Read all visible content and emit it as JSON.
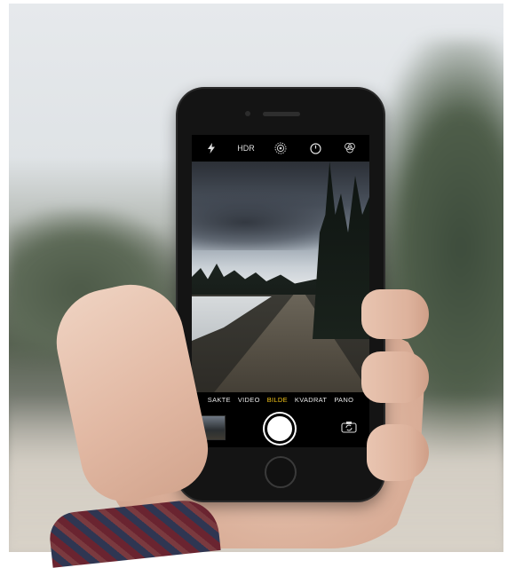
{
  "camera_app": {
    "top_controls": {
      "flash_icon": "flash-icon",
      "hdr_label": "HDR",
      "live_photo_icon": "live-photo-icon",
      "timer_icon": "timer-icon",
      "filters_icon": "filters-icon"
    },
    "modes": [
      {
        "label": "SAKTE",
        "active": false
      },
      {
        "label": "VIDEO",
        "active": false
      },
      {
        "label": "BILDE",
        "active": true
      },
      {
        "label": "KVADRAT",
        "active": false
      },
      {
        "label": "PANO",
        "active": false
      }
    ],
    "bottom_controls": {
      "thumbnail": "last-photo-thumbnail",
      "shutter": "shutter-button",
      "switch_camera_icon": "switch-camera-icon"
    },
    "accent_color": "#f5c518"
  }
}
